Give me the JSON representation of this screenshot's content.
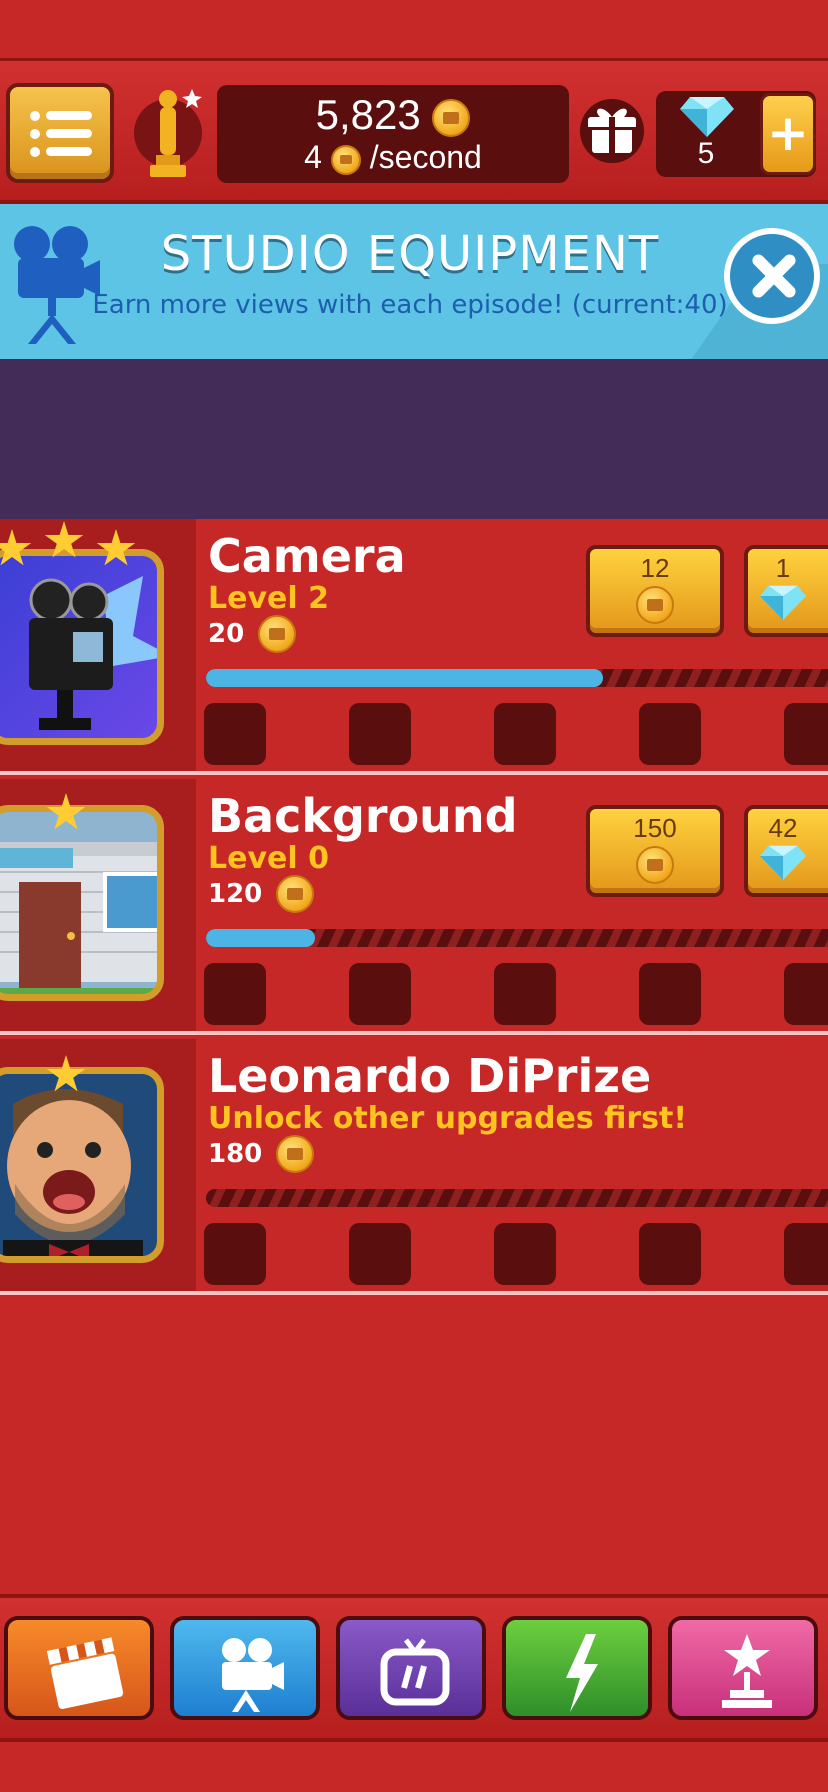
{
  "top_bar": {
    "coins": "5,823",
    "rate_value": "4",
    "rate_unit": "/second",
    "gems": "5",
    "add_gems_label": "+"
  },
  "banner": {
    "title": "STUDIO EQUIPMENT",
    "subtitle": "Earn more views with each episode! (current:40)"
  },
  "upgrades": [
    {
      "name": "Camera",
      "status": "Level 2",
      "views": "20",
      "stars": 3,
      "progress": 0.62,
      "coin_price": "12",
      "gem_price": "1"
    },
    {
      "name": "Background",
      "status": "Level 0",
      "views": "120",
      "stars": 1,
      "progress": 0.17,
      "coin_price": "150",
      "gem_price": "42"
    },
    {
      "name": "Leonardo DiPrize",
      "status": "Unlock other upgrades first!",
      "views": "180",
      "stars": 1,
      "progress": 0
    }
  ],
  "bottom_nav": [
    {
      "icon": "clapperboard-icon",
      "color": "#ef6c1f"
    },
    {
      "icon": "movie-camera-icon",
      "color": "#2f8fd6"
    },
    {
      "icon": "tv-icon",
      "color": "#6a3fa0"
    },
    {
      "icon": "lightning-icon",
      "color": "#3fa43a"
    },
    {
      "icon": "star-trophy-icon",
      "color": "#e0408a"
    }
  ]
}
